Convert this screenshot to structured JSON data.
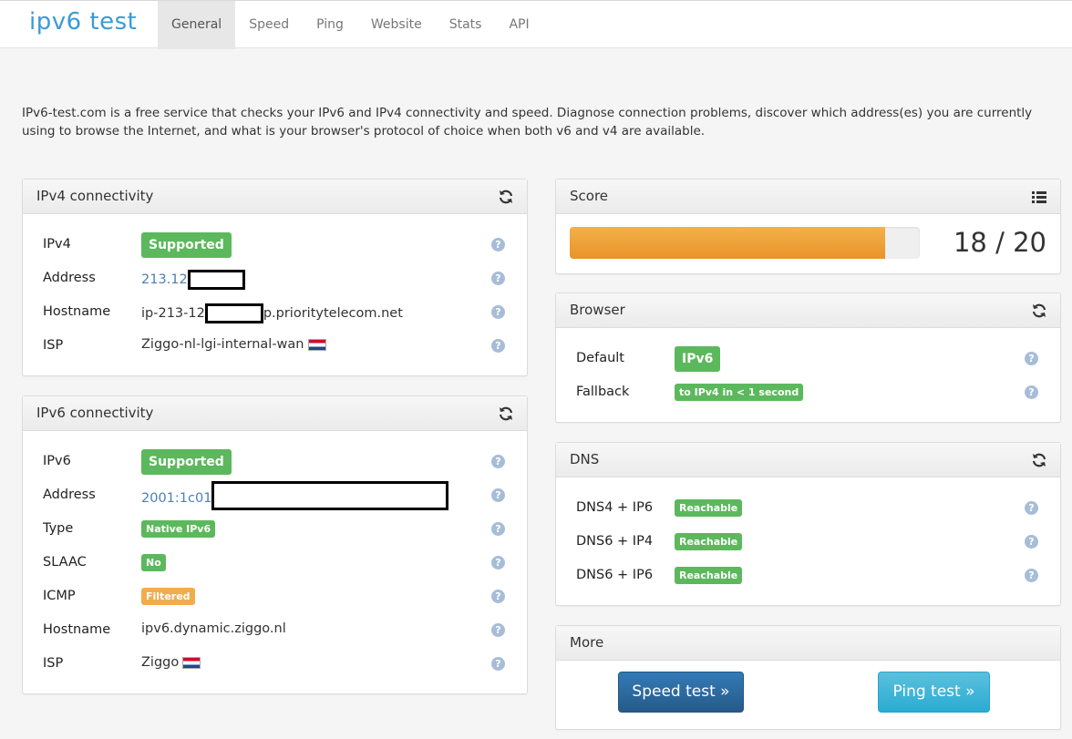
{
  "nav": {
    "brand_1": "ipv6",
    "brand_2": " test",
    "items": [
      "General",
      "Speed",
      "Ping",
      "Website",
      "Stats",
      "API"
    ],
    "active": "General"
  },
  "intro": "IPv6-test.com is a free service that checks your IPv6 and IPv4 connectivity and speed. Diagnose connection problems, discover which address(es) you are currently using to browse the Internet, and what is your browser's protocol of choice when both v6 and v4 are available.",
  "ipv4": {
    "title": "IPv4 connectivity",
    "rows": {
      "ipv4_label": "IPv4",
      "ipv4_value": "Supported",
      "address_label": "Address",
      "address_value": "213.12",
      "hostname_label": "Hostname",
      "hostname_prefix": "ip-213-12",
      "hostname_suffix": "p.prioritytelecom.net",
      "isp_label": "ISP",
      "isp_value": "Ziggo-nl-lgi-internal-wan"
    }
  },
  "ipv6": {
    "title": "IPv6 connectivity",
    "rows": {
      "ipv6_label": "IPv6",
      "ipv6_value": "Supported",
      "address_label": "Address",
      "address_value": "2001:1c01",
      "type_label": "Type",
      "type_value": "Native IPv6",
      "slaac_label": "SLAAC",
      "slaac_value": "No",
      "icmp_label": "ICMP",
      "icmp_value": "Filtered",
      "hostname_label": "Hostname",
      "hostname_value": "ipv6.dynamic.ziggo.nl",
      "isp_label": "ISP",
      "isp_value": "Ziggo"
    }
  },
  "score": {
    "title": "Score",
    "text": "18 / 20",
    "fraction": 0.9
  },
  "browser": {
    "title": "Browser",
    "default_label": "Default",
    "default_value": "IPv6",
    "fallback_label": "Fallback",
    "fallback_value": "to IPv4 in < 1 second"
  },
  "dns": {
    "title": "DNS",
    "rows": [
      {
        "label": "DNS4 + IP6",
        "value": "Reachable"
      },
      {
        "label": "DNS6 + IP4",
        "value": "Reachable"
      },
      {
        "label": "DNS6 + IP6",
        "value": "Reachable"
      }
    ]
  },
  "more": {
    "title": "More",
    "speed_button": "Speed test »",
    "ping_button": "Ping test »"
  },
  "help_glyph": "?",
  "colors": {
    "success": "#5cb85c",
    "warning": "#f0ad4e",
    "primary": "#337ab7",
    "info": "#5bc0de"
  }
}
